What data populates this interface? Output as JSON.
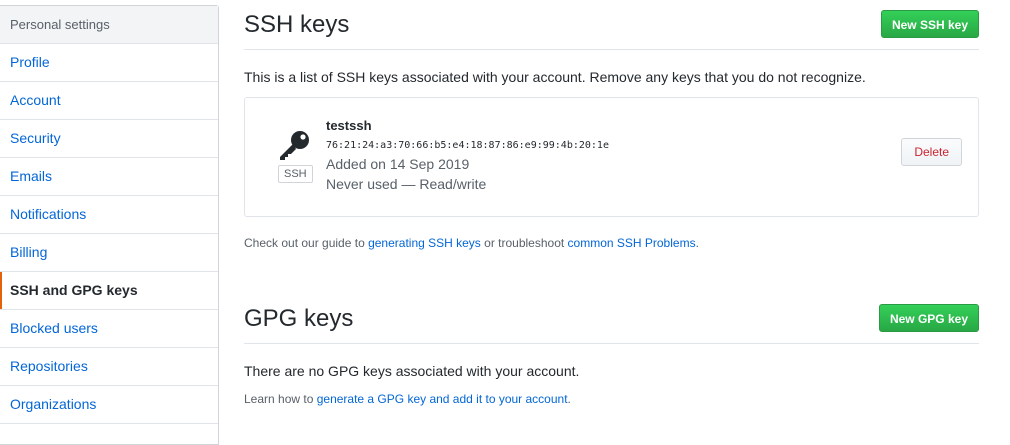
{
  "sidebar": {
    "header": "Personal settings",
    "items": [
      {
        "label": "Profile"
      },
      {
        "label": "Account"
      },
      {
        "label": "Security"
      },
      {
        "label": "Emails"
      },
      {
        "label": "Notifications"
      },
      {
        "label": "Billing"
      },
      {
        "label": "SSH and GPG keys",
        "selected": true
      },
      {
        "label": "Blocked users"
      },
      {
        "label": "Repositories"
      },
      {
        "label": "Organizations"
      }
    ]
  },
  "ssh": {
    "title": "SSH keys",
    "new_button": "New SSH key",
    "intro": "This is a list of SSH keys associated with your account. Remove any keys that you do not recognize.",
    "key": {
      "icon": "key-icon",
      "type_badge": "SSH",
      "title": "testssh",
      "fingerprint": "76:21:24:a3:70:66:b5:e4:18:87:86:e9:99:4b:20:1e",
      "added": "Added on 14 Sep 2019",
      "usage": "Never used — Read/write",
      "delete_button": "Delete"
    },
    "note_prefix": "Check out our guide to ",
    "note_link1": "generating SSH keys",
    "note_middle": " or troubleshoot ",
    "note_link2": "common SSH Problems",
    "note_suffix": "."
  },
  "gpg": {
    "title": "GPG keys",
    "new_button": "New GPG key",
    "empty_text": "There are no GPG keys associated with your account.",
    "note_prefix": "Learn how to ",
    "note_link": "generate a GPG key and add it to your account",
    "note_suffix": "."
  },
  "colors": {
    "accent_selected": "#e36209",
    "primary_button": "#2ea44f",
    "danger_text": "#cb2431",
    "link": "#0366d6"
  }
}
